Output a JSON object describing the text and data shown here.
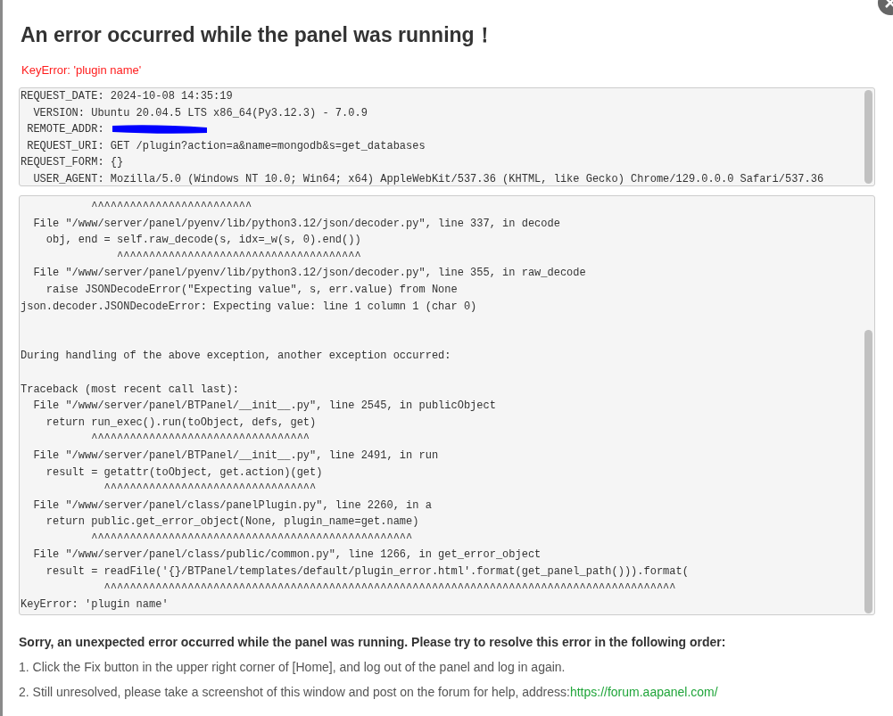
{
  "dialog": {
    "title": "An error occurred while the panel was running！",
    "error": "KeyError: 'plugin name'"
  },
  "request_info": [
    {
      "text": "REQUEST_DATE: 2024-10-08 14:35:19",
      "redacted": false
    },
    {
      "text": "  VERSION: Ubuntu 20.04.5 LTS x86_64(Py3.12.3) - 7.0.9",
      "redacted": false
    },
    {
      "text": " REMOTE_ADDR: ",
      "redacted": true
    },
    {
      "text": " REQUEST_URI: GET /plugin?action=a&name=mongodb&s=get_databases",
      "redacted": false
    },
    {
      "text": "REQUEST_FORM: {}",
      "redacted": false
    },
    {
      "text": "  USER_AGENT: Mozilla/5.0 (Windows NT 10.0; Win64; x64) AppleWebKit/537.36 (KHTML, like Gecko) Chrome/129.0.0.0 Safari/537.36",
      "redacted": false
    }
  ],
  "traceback": "           ^^^^^^^^^^^^^^^^^^^^^^^^^\n  File \"/www/server/panel/pyenv/lib/python3.12/json/decoder.py\", line 337, in decode\n    obj, end = self.raw_decode(s, idx=_w(s, 0).end())\n               ^^^^^^^^^^^^^^^^^^^^^^^^^^^^^^^^^^^^^^\n  File \"/www/server/panel/pyenv/lib/python3.12/json/decoder.py\", line 355, in raw_decode\n    raise JSONDecodeError(\"Expecting value\", s, err.value) from None\njson.decoder.JSONDecodeError: Expecting value: line 1 column 1 (char 0)\n\n\nDuring handling of the above exception, another exception occurred:\n\nTraceback (most recent call last):\n  File \"/www/server/panel/BTPanel/__init__.py\", line 2545, in publicObject\n    return run_exec().run(toObject, defs, get)\n           ^^^^^^^^^^^^^^^^^^^^^^^^^^^^^^^^^^\n  File \"/www/server/panel/BTPanel/__init__.py\", line 2491, in run\n    result = getattr(toObject, get.action)(get)\n             ^^^^^^^^^^^^^^^^^^^^^^^^^^^^^^^^^\n  File \"/www/server/panel/class/panelPlugin.py\", line 2260, in a\n    return public.get_error_object(None, plugin_name=get.name)\n           ^^^^^^^^^^^^^^^^^^^^^^^^^^^^^^^^^^^^^^^^^^^^^^^^^^\n  File \"/www/server/panel/class/public/common.py\", line 1266, in get_error_object\n    result = readFile('{}/BTPanel/templates/default/plugin_error.html'.format(get_panel_path())).format(\n             ^^^^^^^^^^^^^^^^^^^^^^^^^^^^^^^^^^^^^^^^^^^^^^^^^^^^^^^^^^^^^^^^^^^^^^^^^^^^^^^^^^^^^^^^^\nKeyError: 'plugin name'",
  "help": {
    "heading": "Sorry, an unexpected error occurred while the panel was running. Please try to resolve this error in the following order:",
    "steps": [
      {
        "text": "1. Click the Fix button in the upper right corner of [Home], and log out of the panel and log in again."
      },
      {
        "text": "2. Still unresolved, please take a screenshot of this window and post on the forum for help, address:",
        "link": "https://forum.aapanel.com/"
      }
    ]
  }
}
